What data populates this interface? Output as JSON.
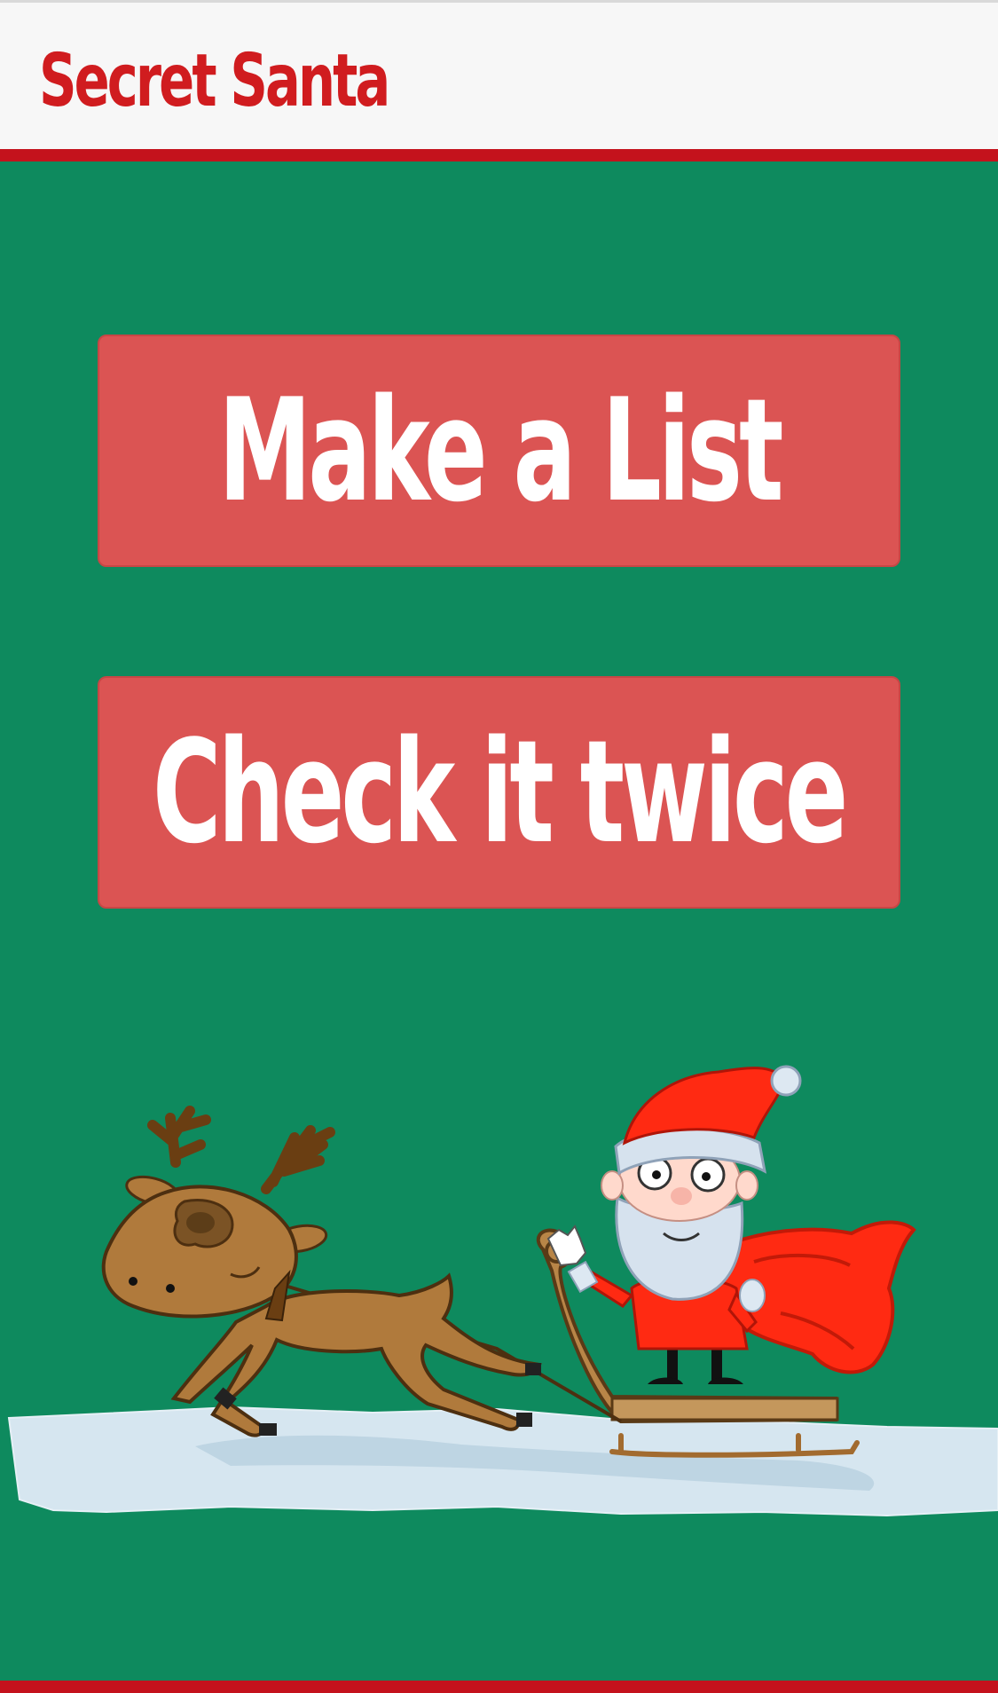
{
  "header": {
    "title": "Secret Santa"
  },
  "main": {
    "buttons": [
      {
        "label": "Make a List"
      },
      {
        "label": "Check it twice"
      }
    ]
  },
  "colors": {
    "background": "#0e8a5e",
    "header_bg": "#f7f7f7",
    "accent_red": "#c4121c",
    "button_bg": "#db5453",
    "button_text": "#ffffff",
    "title_text": "#d01c1f"
  },
  "illustration": {
    "subjects": [
      "reindeer",
      "sleigh",
      "santa-claus",
      "gift-sack",
      "snow"
    ]
  }
}
